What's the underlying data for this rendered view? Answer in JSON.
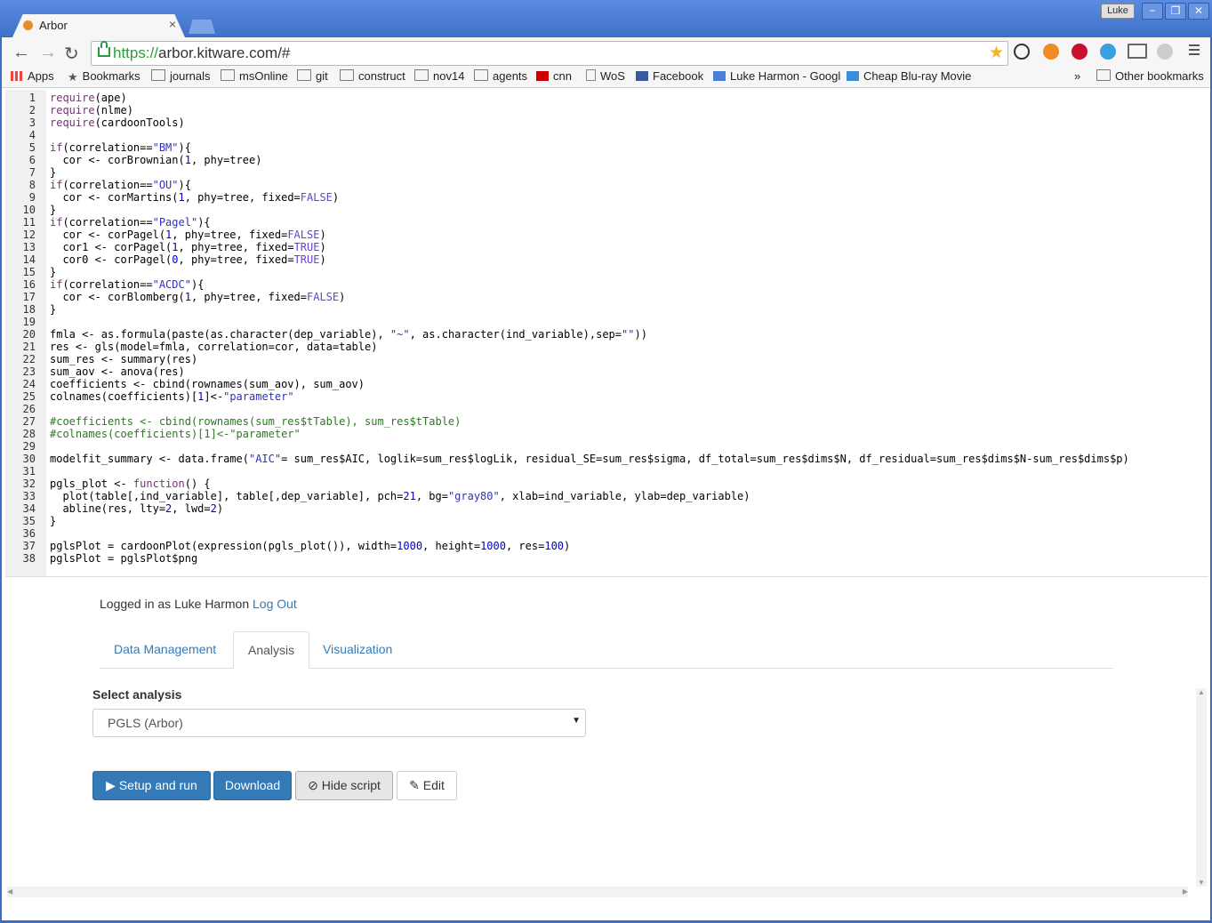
{
  "browser": {
    "tab_title": "Arbor",
    "tab_close": "×",
    "profile_name": "Luke",
    "url_scheme": "https://",
    "url_rest": "arbor.kitware.com/#",
    "window_buttons": {
      "minimize": "−",
      "restore": "❐",
      "close": "✕"
    }
  },
  "bookmarks": [
    {
      "label": "Apps",
      "icon": "apps-grid-icon"
    },
    {
      "label": "Bookmarks",
      "icon": "star-icon"
    },
    {
      "label": "journals",
      "icon": "folder-icon"
    },
    {
      "label": "msOnline",
      "icon": "folder-icon"
    },
    {
      "label": "git",
      "icon": "folder-icon"
    },
    {
      "label": "construct",
      "icon": "folder-icon"
    },
    {
      "label": "nov14",
      "icon": "folder-icon"
    },
    {
      "label": "agents",
      "icon": "folder-icon"
    },
    {
      "label": "cnn",
      "icon": "cnn-icon"
    },
    {
      "label": "WoS",
      "icon": "page-icon"
    },
    {
      "label": "Facebook",
      "icon": "facebook-icon"
    },
    {
      "label": "Luke Harmon - Googl",
      "icon": "scholar-icon"
    },
    {
      "label": "Cheap Blu-ray Movie",
      "icon": "b-icon"
    }
  ],
  "bookmarks_overflow": "»",
  "other_bookmarks": "Other bookmarks",
  "code_lines": [
    "require(ape)",
    "require(nlme)",
    "require(cardoonTools)",
    "",
    "if(correlation==\"BM\"){",
    "  cor <- corBrownian(1, phy=tree)",
    "}",
    "if(correlation==\"OU\"){",
    "  cor <- corMartins(1, phy=tree, fixed=FALSE)",
    "}",
    "if(correlation==\"Pagel\"){",
    "  cor <- corPagel(1, phy=tree, fixed=FALSE)",
    "  cor1 <- corPagel(1, phy=tree, fixed=TRUE)",
    "  cor0 <- corPagel(0, phy=tree, fixed=TRUE)",
    "}",
    "if(correlation==\"ACDC\"){",
    "  cor <- corBlomberg(1, phy=tree, fixed=FALSE)",
    "}",
    "",
    "fmla <- as.formula(paste(as.character(dep_variable), \"~\", as.character(ind_variable),sep=\"\"))",
    "res <- gls(model=fmla, correlation=cor, data=table)",
    "sum_res <- summary(res)",
    "sum_aov <- anova(res)",
    "coefficients <- cbind(rownames(sum_aov), sum_aov)",
    "colnames(coefficients)[1]<-\"parameter\"",
    "",
    "#coefficients <- cbind(rownames(sum_res$tTable), sum_res$tTable)",
    "#colnames(coefficients)[1]<-\"parameter\"",
    "",
    "modelfit_summary <- data.frame(\"AIC\"= sum_res$AIC, loglik=sum_res$logLik, residual_SE=sum_res$sigma, df_total=sum_res$dims$N, df_residual=sum_res$dims$N-sum_res$dims$p)",
    "",
    "pgls_plot <- function() {",
    "  plot(table[,ind_variable], table[,dep_variable], pch=21, bg=\"gray80\", xlab=ind_variable, ylab=dep_variable)",
    "  abline(res, lty=2, lwd=2)",
    "}",
    "",
    "pglsPlot = cardoonPlot(expression(pgls_plot()), width=1000, height=1000, res=100)",
    "pglsPlot = pglsPlot$png"
  ],
  "login": {
    "prefix": "Logged in as Luke Harmon",
    "logout": "Log Out"
  },
  "tabs": [
    "Data Management",
    "Analysis",
    "Visualization"
  ],
  "select_label": "Select analysis",
  "select_value": "PGLS (Arbor)",
  "buttons": {
    "setup": "Setup and run",
    "download": "Download",
    "hide": "Hide script",
    "edit": "Edit"
  },
  "colors": {
    "keyword": "#7a2f7a",
    "string": "#3030c0",
    "number": "#0000cc",
    "constant": "#6a3fd6",
    "comment": "#2a7a1f",
    "accent": "#337ab7"
  }
}
